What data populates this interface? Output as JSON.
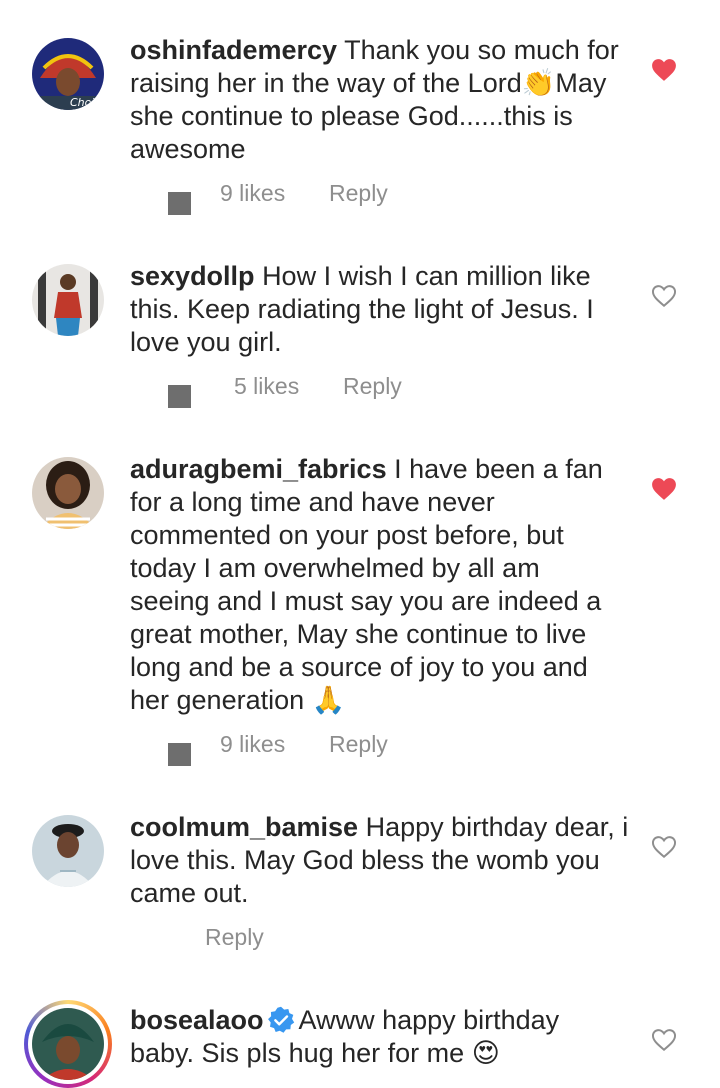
{
  "comments": [
    {
      "username": "oshinfademercy",
      "text_a": "Thank you so much for raising her in the way of the Lord",
      "emoji_a": "👏",
      "text_b": "May she continue to please God......this is awesome",
      "likes": "9 likes",
      "reply": "Reply",
      "liked": true
    },
    {
      "username": "sexydollp",
      "text": "How I wish I can million like this. Keep radiating the light of Jesus. I love you girl.",
      "likes": "5 likes",
      "reply": "Reply",
      "liked": false
    },
    {
      "username": "aduragbemi_fabrics",
      "text": "I have been a fan for a long time and have never commented on your post before, but today I am overwhelmed by all am seeing and I must say you are indeed a great mother, May she continue to live long and be a source of joy to you and her generation",
      "emoji": "🙏",
      "likes": "9 likes",
      "reply": "Reply",
      "liked": true
    },
    {
      "username": "coolmum_bamise",
      "text": "Happy birthday dear, i love this. May God bless the womb you came out.",
      "reply": "Reply",
      "liked": false
    },
    {
      "username": "bosealaoo",
      "verified": true,
      "text": "Awww happy birthday baby.  Sis pls hug her for me",
      "emoji": "😍",
      "liked": false
    }
  ],
  "colors": {
    "text": "#262626",
    "muted": "#8e8e8e",
    "heart_liked": "#ed4956",
    "verified": "#3897f0"
  },
  "icons": {
    "liked": "heart-filled-icon",
    "unliked": "heart-outline-icon",
    "verified": "verified-badge-icon"
  }
}
